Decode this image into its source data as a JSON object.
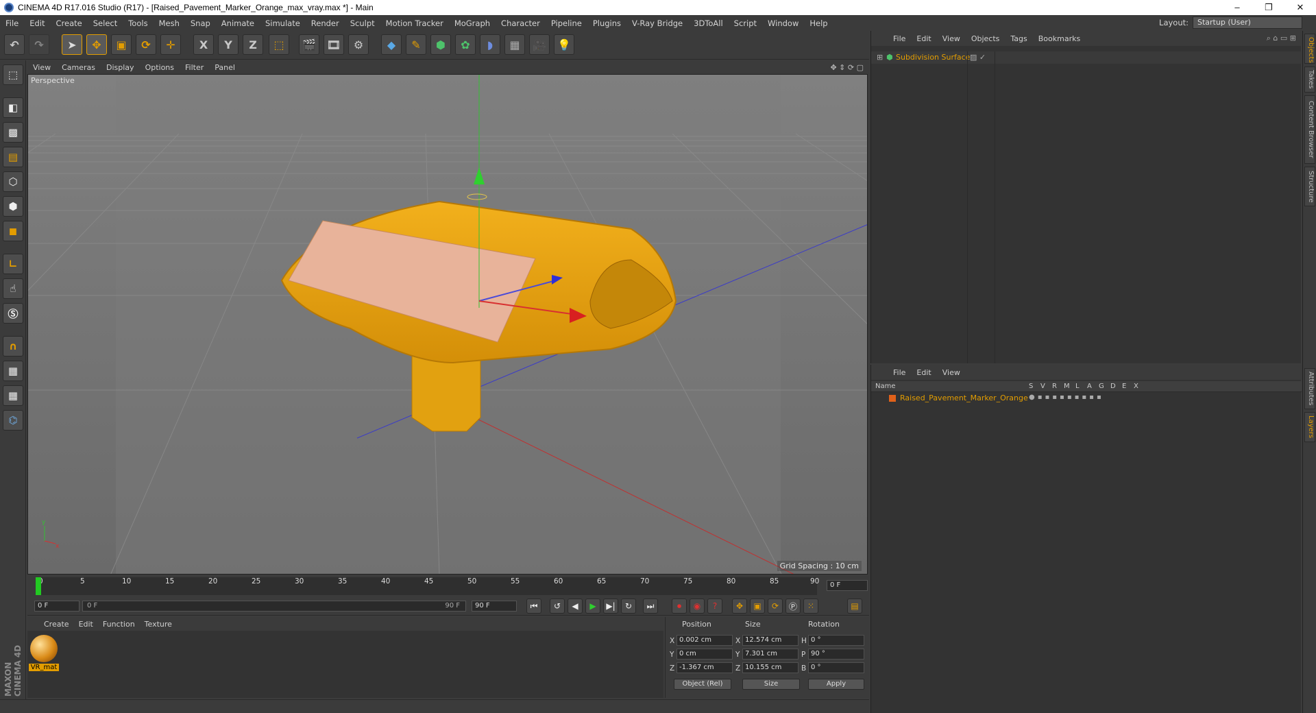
{
  "window": {
    "title": "CINEMA 4D R17.016 Studio (R17) - [Raised_Pavement_Marker_Orange_max_vray.max *] - Main",
    "minimize": "–",
    "maximize": "❐",
    "close": "✕"
  },
  "menu": [
    "File",
    "Edit",
    "Create",
    "Select",
    "Tools",
    "Mesh",
    "Snap",
    "Animate",
    "Simulate",
    "Render",
    "Sculpt",
    "Motion Tracker",
    "MoGraph",
    "Character",
    "Pipeline",
    "Plugins",
    "V-Ray Bridge",
    "3DToAll",
    "Script",
    "Window",
    "Help"
  ],
  "layout": {
    "label": "Layout:",
    "value": "Startup (User)"
  },
  "toolbar": {
    "axis_x": "X",
    "axis_y": "Y",
    "axis_z": "Z"
  },
  "viewport": {
    "menu": [
      "View",
      "Cameras",
      "Display",
      "Options",
      "Filter",
      "Panel"
    ],
    "label": "Perspective",
    "grid_spacing": "Grid Spacing : 10 cm"
  },
  "timeline": {
    "ticks": [
      "0",
      "5",
      "10",
      "15",
      "20",
      "25",
      "30",
      "35",
      "40",
      "45",
      "50",
      "55",
      "60",
      "65",
      "70",
      "75",
      "80",
      "85",
      "90"
    ],
    "current_frame": "0 F",
    "start": "0 F",
    "range_start": "0 F",
    "range_end": "90 F",
    "end": "90 F"
  },
  "material_manager": {
    "menu": [
      "Create",
      "Edit",
      "Function",
      "Texture"
    ],
    "material_name": "VR_mat",
    "logo": "MAXON CINEMA 4D"
  },
  "coordinates": {
    "headers": {
      "position": "Position",
      "size": "Size",
      "rotation": "Rotation"
    },
    "rows": [
      {
        "axis": "X",
        "pos": "0.002 cm",
        "size_axis": "X",
        "size": "12.574 cm",
        "rot_axis": "H",
        "rot": "0 °"
      },
      {
        "axis": "Y",
        "pos": "0 cm",
        "size_axis": "Y",
        "size": "7.301 cm",
        "rot_axis": "P",
        "rot": "90 °"
      },
      {
        "axis": "Z",
        "pos": "-1.367 cm",
        "size_axis": "Z",
        "size": "10.155 cm",
        "rot_axis": "B",
        "rot": "0 °"
      }
    ],
    "mode": "Object (Rel)",
    "size_mode": "Size",
    "apply": "Apply"
  },
  "objects_panel": {
    "menu": [
      "File",
      "Edit",
      "View",
      "Objects",
      "Tags",
      "Bookmarks"
    ],
    "object_name": "Subdivision Surface"
  },
  "layers_panel": {
    "menu": [
      "File",
      "Edit",
      "View"
    ],
    "columns": [
      "Name",
      "S",
      "V",
      "R",
      "M",
      "L",
      "A",
      "G",
      "D",
      "E",
      "X"
    ],
    "layer_name": "Raised_Pavement_Marker_Orange"
  },
  "side_tabs": [
    "Objects",
    "Takes",
    "Content Browser",
    "Structure",
    "Attributes",
    "Layers"
  ],
  "colors": {
    "accent": "#e39d00",
    "bg": "#3b3b3b",
    "viewport": "#7a7a7a",
    "model": "#e8a416"
  }
}
